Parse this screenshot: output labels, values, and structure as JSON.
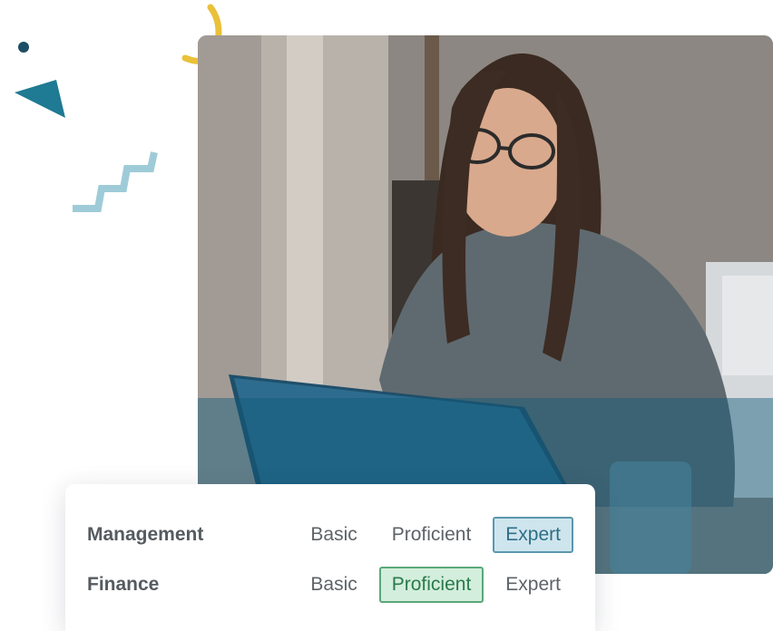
{
  "colors": {
    "accent_yellow": "#e9c13a",
    "accent_teal": "#1f7a93",
    "accent_light_blue": "#9fcbd8",
    "dot": "#1d4e63",
    "selected_blue_bg": "#cfe5ee",
    "selected_green_bg": "#d3eedc"
  },
  "skills": [
    {
      "name": "Management",
      "levels": [
        "Basic",
        "Proficient",
        "Expert"
      ],
      "selected": "Expert"
    },
    {
      "name": "Finance",
      "levels": [
        "Basic",
        "Proficient",
        "Expert"
      ],
      "selected": "Proficient"
    }
  ]
}
